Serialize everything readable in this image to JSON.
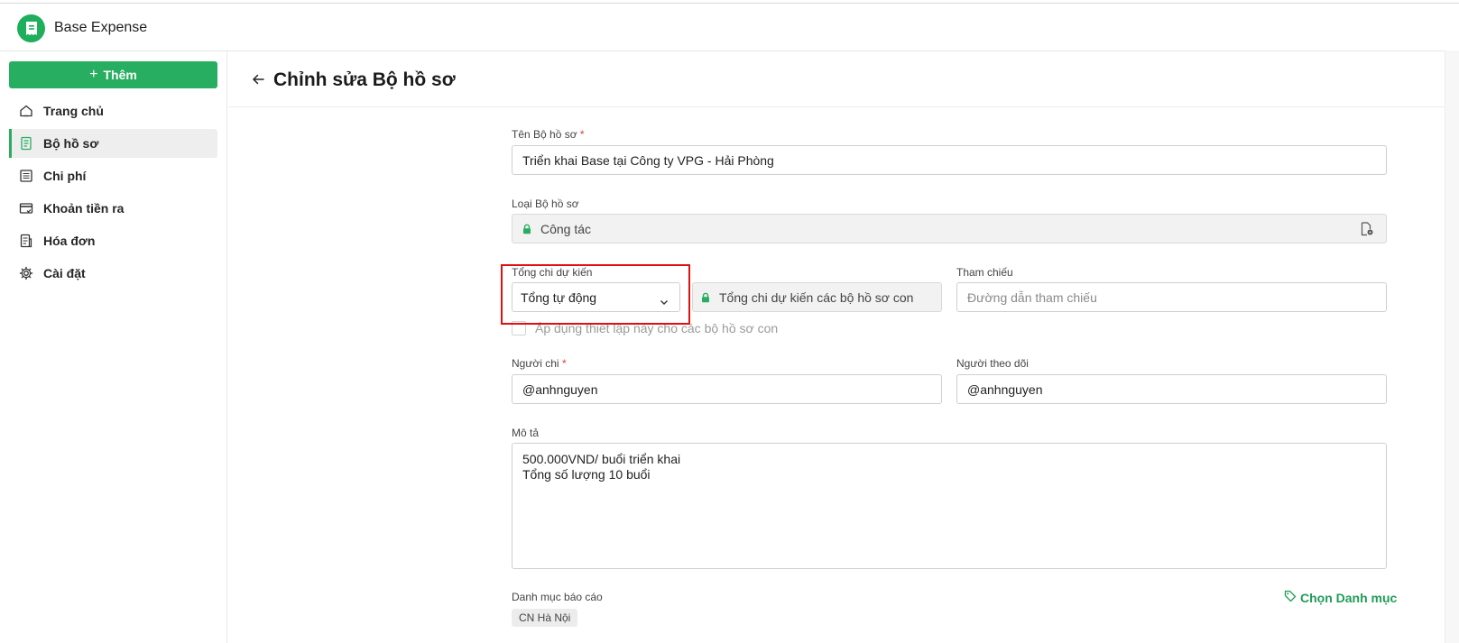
{
  "app": {
    "title": "Base Expense",
    "accent": "#27ae60",
    "logo_icon": "receipt-icon"
  },
  "sidebar": {
    "add_button": "Thêm",
    "items": [
      {
        "label": "Trang chủ",
        "icon": "home-icon",
        "active": false
      },
      {
        "label": "Bộ hồ sơ",
        "icon": "document-icon",
        "active": true
      },
      {
        "label": "Chi phí",
        "icon": "list-icon",
        "active": false
      },
      {
        "label": "Khoản tiền ra",
        "icon": "card-check-icon",
        "active": false
      },
      {
        "label": "Hóa đơn",
        "icon": "invoice-icon",
        "active": false
      },
      {
        "label": "Cài đặt",
        "icon": "gear-icon",
        "active": false
      }
    ]
  },
  "page": {
    "title": "Chỉnh sửa Bộ hồ sơ"
  },
  "form": {
    "name": {
      "label": "Tên Bộ hồ sơ",
      "required_mark": "*",
      "value": "Triển khai Base tại Công ty VPG - Hải Phòng"
    },
    "type": {
      "label": "Loại Bộ hồ sơ",
      "value": "Công tác"
    },
    "expected_total": {
      "label": "Tổng chi dự kiến",
      "selected": "Tổng tự động",
      "locked_value": "Tổng chi dự kiến các bộ hồ sơ con"
    },
    "apply_children": {
      "label": "Áp dụng thiết lập này cho các bộ hồ sơ con",
      "checked": false
    },
    "reference": {
      "label": "Tham chiếu",
      "placeholder": "Đường dẫn tham chiếu"
    },
    "spender": {
      "label": "Người chi",
      "required_mark": "*",
      "value": "@anhnguyen"
    },
    "follower": {
      "label": "Người theo dõi",
      "value": "@anhnguyen"
    },
    "description": {
      "label": "Mô tả",
      "lines": [
        "500.000VND/ buổi triển khai",
        "Tổng số lượng 10 buổi"
      ]
    },
    "report_category": {
      "label": "Danh mục báo cáo",
      "choose_label": "Chọn Danh mục",
      "tags": [
        "CN Hà Nội"
      ]
    }
  }
}
